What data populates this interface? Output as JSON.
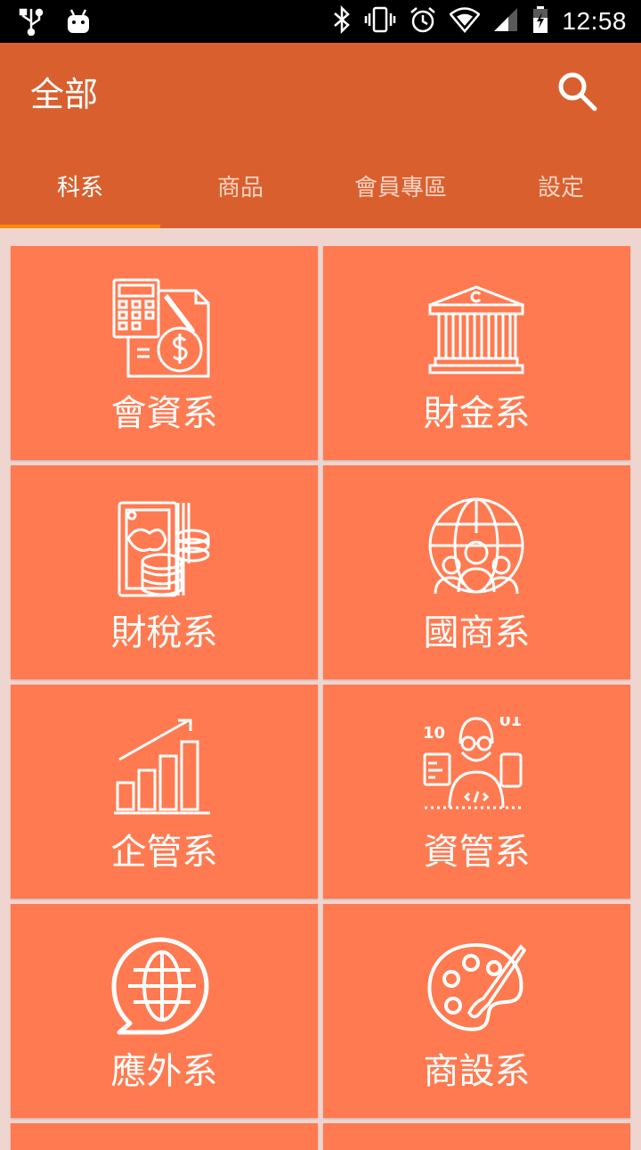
{
  "status_bar": {
    "time": "12:58",
    "icons": [
      "usb-icon",
      "android-icon",
      "bluetooth-icon",
      "vibrate-icon",
      "alarm-icon",
      "wifi-icon",
      "signal-icon",
      "battery-icon"
    ]
  },
  "app_bar": {
    "title": "全部",
    "search_icon": "search-icon"
  },
  "tabs": [
    {
      "label": "科系",
      "active": true
    },
    {
      "label": "商品",
      "active": false
    },
    {
      "label": "會員專區",
      "active": false
    },
    {
      "label": "設定",
      "active": false
    }
  ],
  "departments": [
    {
      "label": "會資系",
      "icon": "accounting-icon"
    },
    {
      "label": "財金系",
      "icon": "bank-icon"
    },
    {
      "label": "財稅系",
      "icon": "money-coins-icon"
    },
    {
      "label": "國商系",
      "icon": "globe-people-icon"
    },
    {
      "label": "企管系",
      "icon": "growth-chart-icon"
    },
    {
      "label": "資管系",
      "icon": "programmer-icon"
    },
    {
      "label": "應外系",
      "icon": "globe-chat-icon"
    },
    {
      "label": "商設系",
      "icon": "palette-icon"
    }
  ],
  "colors": {
    "app_bar": "#d9602e",
    "tab_indicator": "#ff8a00",
    "card": "#ff7a50",
    "background": "#efd5cf"
  }
}
